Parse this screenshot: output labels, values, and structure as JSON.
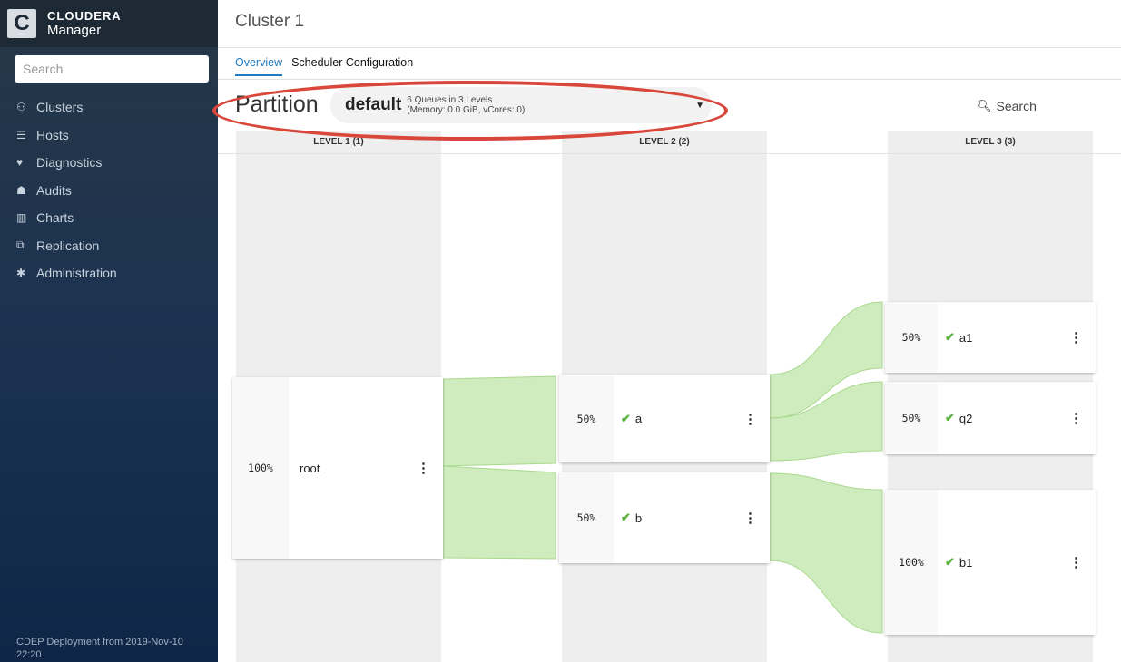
{
  "brand": {
    "logo_letter": "C",
    "name": "CLOUDERA",
    "product": "Manager"
  },
  "sidebar": {
    "search_placeholder": "Search",
    "items": [
      {
        "label": "Clusters",
        "icon": "clusters-icon",
        "glyph": "⚇"
      },
      {
        "label": "Hosts",
        "icon": "hosts-icon",
        "glyph": "☰"
      },
      {
        "label": "Diagnostics",
        "icon": "heartbeat-icon",
        "glyph": "♥"
      },
      {
        "label": "Audits",
        "icon": "binoculars-icon",
        "glyph": "☗"
      },
      {
        "label": "Charts",
        "icon": "bar-chart-icon",
        "glyph": "▥"
      },
      {
        "label": "Replication",
        "icon": "replication-icon",
        "glyph": "⧉"
      },
      {
        "label": "Administration",
        "icon": "gear-icon",
        "glyph": "✱"
      }
    ],
    "footer": "CDEP Deployment from 2019-Nov-10 22:20"
  },
  "header": {
    "title": "Cluster 1",
    "tabs": [
      {
        "label": "Overview",
        "active": true
      },
      {
        "label": "Scheduler Configuration",
        "active": false
      }
    ]
  },
  "partition": {
    "label": "Partition",
    "name": "default",
    "info_line1": "6 Queues in 3 Levels",
    "info_line2": "(Memory: 0.0 GiB, vCores: 0)",
    "search_label": "Search"
  },
  "levels": [
    {
      "label": "LEVEL 1 (1)"
    },
    {
      "label": "LEVEL 2 (2)"
    },
    {
      "label": "LEVEL 3 (3)"
    }
  ],
  "queues": {
    "root": {
      "pct": "100%",
      "name": "root",
      "status": "none"
    },
    "a": {
      "pct": "50%",
      "name": "a",
      "status": "running"
    },
    "b": {
      "pct": "50%",
      "name": "b",
      "status": "running"
    },
    "a1": {
      "pct": "50%",
      "name": "a1",
      "status": "running"
    },
    "q2": {
      "pct": "50%",
      "name": "q2",
      "status": "running"
    },
    "b1": {
      "pct": "100%",
      "name": "b1",
      "status": "running"
    }
  },
  "colors": {
    "accent": "#1f7ac1",
    "highlight": "#d9473b",
    "flow": "#bfe6a8",
    "check": "#59b33c"
  }
}
